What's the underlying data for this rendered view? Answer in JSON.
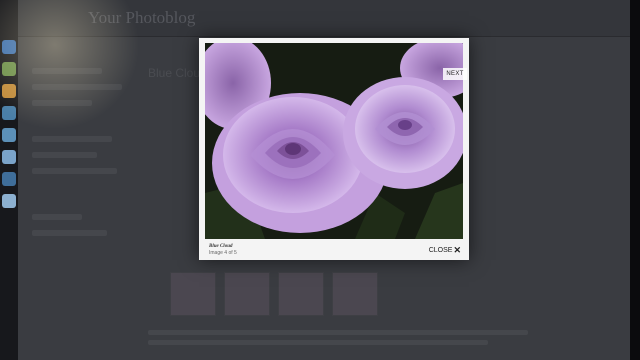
{
  "page": {
    "site_title": "Your Photoblog",
    "header_links": [
      "",
      ""
    ],
    "main_title": "Blue Cloud"
  },
  "lightbox": {
    "photo_alt": "Purple roses",
    "next_label": "NEXT",
    "caption_title": "Blue Cloud",
    "caption_count": "Image 4 of 5",
    "close_label": "CLOSE"
  },
  "colors": {
    "rose_light": "#c9a6e0",
    "rose_mid": "#a77cc8",
    "rose_dark": "#7b4f9a",
    "foliage": "#1e2a18"
  },
  "icons": [
    "next-arrow-icon",
    "close-x-icon"
  ]
}
